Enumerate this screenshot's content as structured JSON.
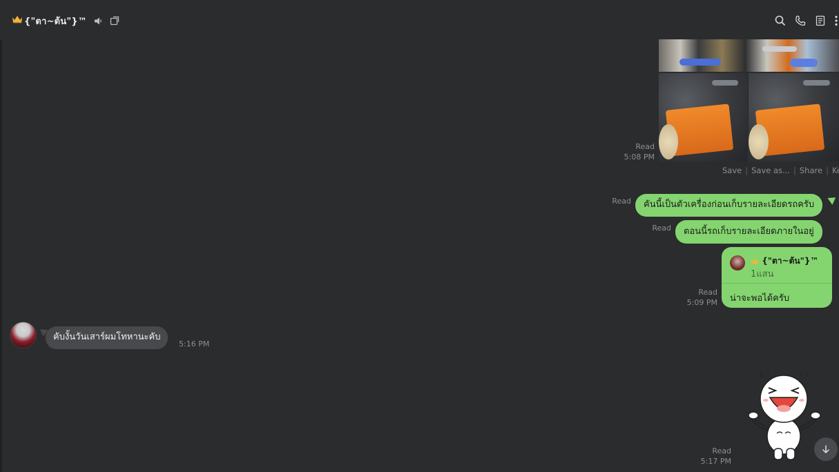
{
  "header": {
    "crown_icon": "crown-icon",
    "title": "{\"ตา~ต้น\"}™",
    "icons": [
      "speaker-icon",
      "external-window-icon"
    ],
    "actions": [
      "search-icon",
      "phone-icon",
      "notes-icon",
      "more-icon"
    ]
  },
  "messages": {
    "photo": {
      "status": "Read",
      "time": "5:08 PM"
    },
    "photo_actions": [
      "Save",
      "Save as...",
      "Share",
      "Keep"
    ],
    "out1": {
      "status": "Read",
      "text": "คันนี้เป็นตัวเครื่องก่อนเก็บรายละเอียดรถครับ"
    },
    "out2": {
      "status": "Read",
      "text": "ตอนนี้รถเก็บรายละเอียดภายในอยู่"
    },
    "reply": {
      "status": "Read",
      "time": "5:09 PM",
      "quoted_name": "{\"ตา~ต้น\"}™",
      "quoted_text": "1แสน",
      "text": "น่าจะพอได้ครับ"
    },
    "in1": {
      "text": "คับงั้นวันเสาร์ผมโทหานะคับ",
      "time": "5:16 PM"
    },
    "sticker": {
      "status": "Read",
      "time": "5:17 PM"
    }
  },
  "colors": {
    "background": "#2b2c2e",
    "outgoing_bubble": "#84d56f",
    "incoming_bubble": "#48494c",
    "meta_text": "#8d8f93"
  }
}
